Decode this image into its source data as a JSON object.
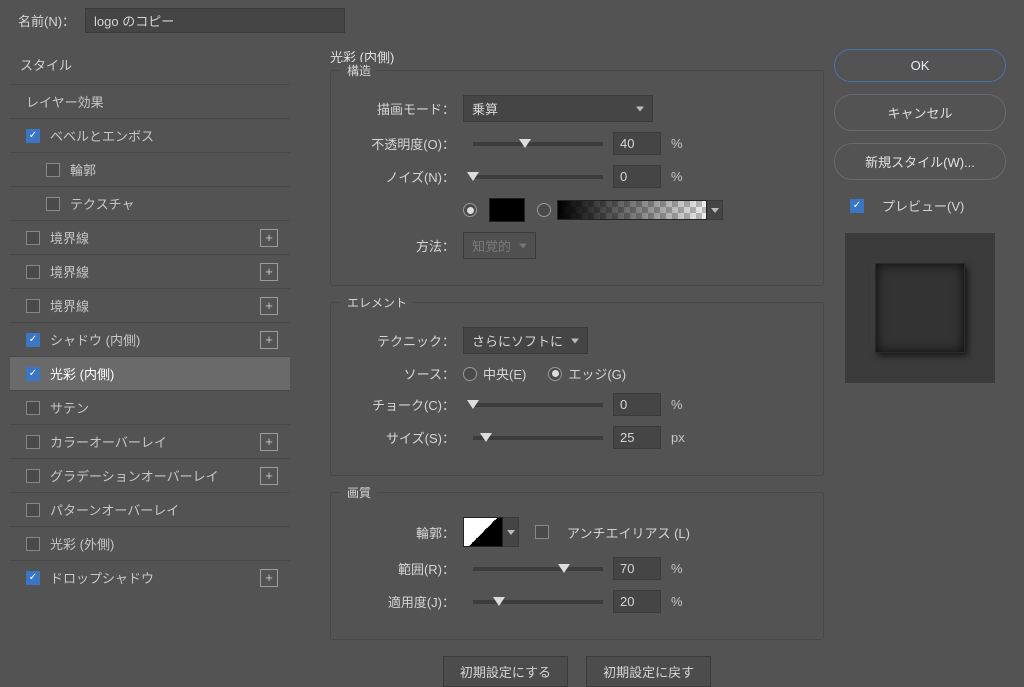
{
  "nameLabel": "名前(N)：",
  "nameValue": "logo のコピー",
  "sidebar": {
    "header": "スタイル",
    "blendingOptions": "レイヤー効果",
    "items": [
      {
        "label": "ベベルとエンボス",
        "checked": true,
        "plus": false
      },
      {
        "label": "輪郭",
        "checked": false,
        "plus": false,
        "sub": true
      },
      {
        "label": "テクスチャ",
        "checked": false,
        "plus": false,
        "sub": true
      },
      {
        "label": "境界線",
        "checked": false,
        "plus": true
      },
      {
        "label": "境界線",
        "checked": false,
        "plus": true
      },
      {
        "label": "境界線",
        "checked": false,
        "plus": true
      },
      {
        "label": "シャドウ (内側)",
        "checked": true,
        "plus": true
      },
      {
        "label": "光彩 (内側)",
        "checked": true,
        "plus": false,
        "selected": true
      },
      {
        "label": "サテン",
        "checked": false,
        "plus": false
      },
      {
        "label": "カラーオーバーレイ",
        "checked": false,
        "plus": true
      },
      {
        "label": "グラデーションオーバーレイ",
        "checked": false,
        "plus": true
      },
      {
        "label": "パターンオーバーレイ",
        "checked": false,
        "plus": false
      },
      {
        "label": "光彩 (外側)",
        "checked": false,
        "plus": false
      },
      {
        "label": "ドロップシャドウ",
        "checked": true,
        "plus": true
      }
    ]
  },
  "panelTitle": "光彩 (内側)",
  "structure": {
    "title": "構造",
    "blendModeLabel": "描画モード：",
    "blendMode": "乗算",
    "opacityLabel": "不透明度(O)：",
    "opacity": "40",
    "noiseLabel": "ノイズ(N)：",
    "noise": "0",
    "methodLabel": "方法：",
    "method": "知覚的",
    "pct": "%"
  },
  "elements": {
    "title": "エレメント",
    "techniqueLabel": "テクニック：",
    "technique": "さらにソフトに",
    "sourceLabel": "ソース：",
    "sourceCenter": "中央(E)",
    "sourceEdge": "エッジ(G)",
    "chokeLabel": "チョーク(C)：",
    "choke": "0",
    "sizeLabel": "サイズ(S)：",
    "size": "25",
    "pct": "%",
    "px": "px"
  },
  "quality": {
    "title": "画質",
    "contourLabel": "輪郭：",
    "antialias": "アンチエイリアス (L)",
    "rangeLabel": "範囲(R)：",
    "range": "70",
    "jitterLabel": "適用度(J)：",
    "jitter": "20",
    "pct": "%"
  },
  "buttons": {
    "makeDefault": "初期設定にする",
    "resetDefault": "初期設定に戻す",
    "ok": "OK",
    "cancel": "キャンセル",
    "newStyle": "新規スタイル(W)...",
    "preview": "プレビュー(V)"
  }
}
